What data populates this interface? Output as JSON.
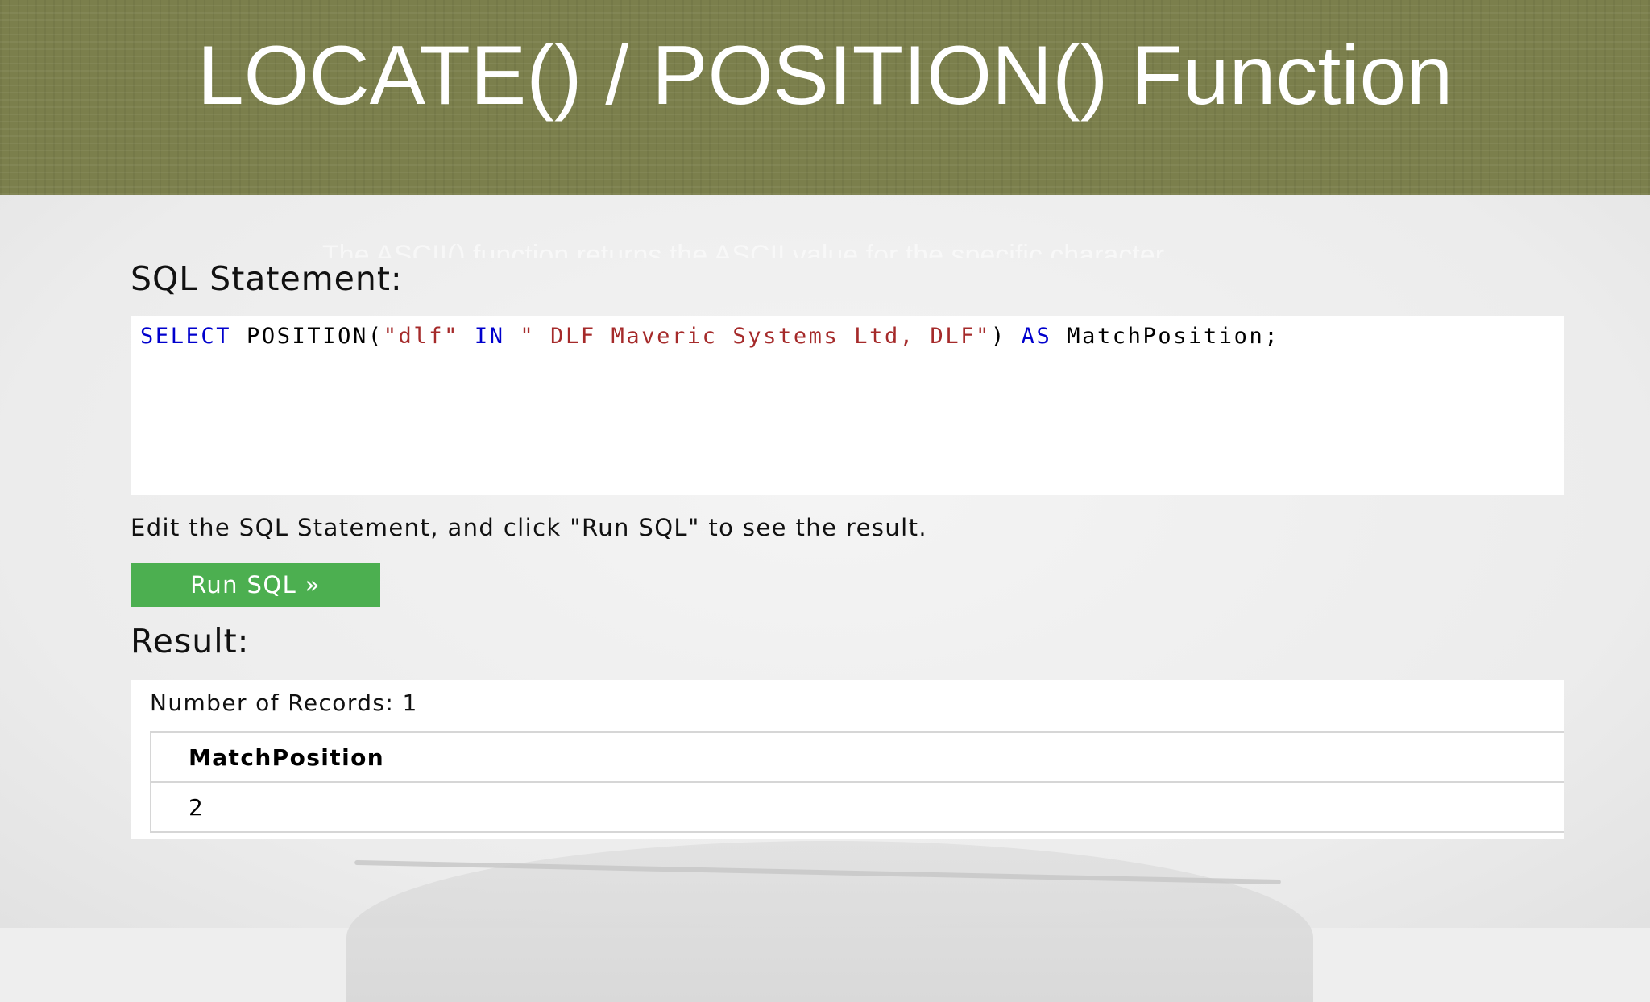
{
  "slide": {
    "title": "LOCATE() / POSITION() Function",
    "ghost_text": "The ASCII() function returns the ASCII value for the specific character"
  },
  "editor": {
    "heading": "SQL Statement:",
    "code": {
      "t1": "SELECT",
      "t2": " POSITION(",
      "t3": "\"dlf\"",
      "t4": " ",
      "t5": "IN",
      "t6": " ",
      "t7": "\" DLF Maveric Systems Ltd, DLF\"",
      "t8": ") ",
      "t9": "AS",
      "t10": " MatchPosition;"
    }
  },
  "instruction": "Edit the SQL Statement, and click \"Run SQL\" to see the result.",
  "run_button": {
    "label": "Run SQL »"
  },
  "result": {
    "heading": "Result:",
    "records": "Number of Records: 1",
    "columns": [
      "MatchPosition"
    ],
    "rows": [
      [
        "2"
      ]
    ]
  },
  "colors": {
    "title_band": "#7b7f4c",
    "keyword": "#0000cd",
    "string": "#a52a2a",
    "run_button": "#4caf50"
  }
}
